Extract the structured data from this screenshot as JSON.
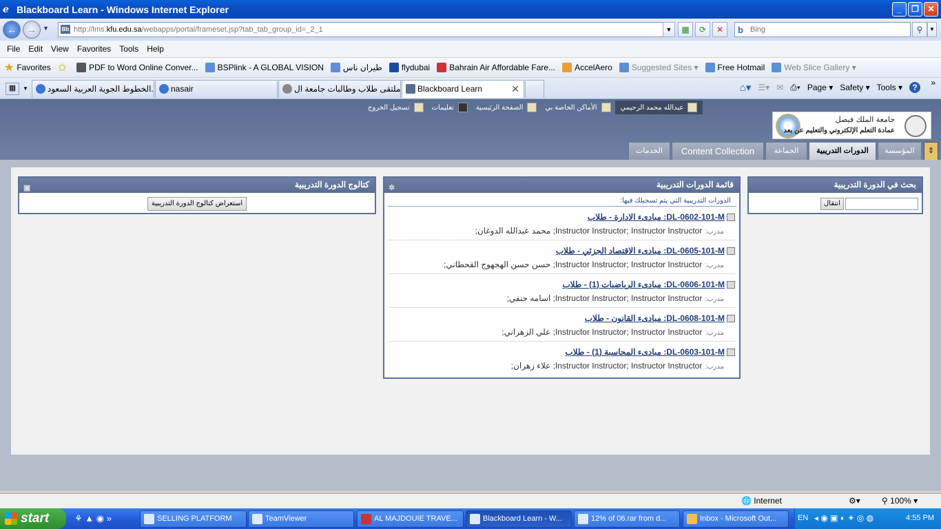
{
  "window": {
    "title": "Blackboard Learn - Windows Internet Explorer"
  },
  "address": {
    "url_prefix": "http://lms.",
    "url_domain": "kfu.edu.sa",
    "url_suffix": "/webapps/portal/frameset.jsp?tab_tab_group_id=_2_1",
    "favicon": "Bb",
    "search_placeholder": "Bing"
  },
  "menu": [
    "File",
    "Edit",
    "View",
    "Favorites",
    "Tools",
    "Help"
  ],
  "favorites_bar": {
    "label": "Favorites",
    "items": [
      {
        "label": "PDF to Word Online Conver...",
        "gray": false
      },
      {
        "label": "BSPlink - A GLOBAL VISION",
        "gray": false
      },
      {
        "label": "طيران ناس",
        "gray": false
      },
      {
        "label": "flydubai",
        "gray": false
      },
      {
        "label": "Bahrain Air  Affordable Fare...",
        "gray": false
      },
      {
        "label": "AccelAero",
        "gray": false
      },
      {
        "label": "Suggested Sites ▾",
        "gray": true
      },
      {
        "label": "Free Hotmail",
        "gray": false
      },
      {
        "label": "Web Slice Gallery ▾",
        "gray": true
      }
    ]
  },
  "ie_tabs": [
    {
      "label": "الخطوط الجوية العربية السعود...",
      "active": false
    },
    {
      "label": "nasair",
      "active": false
    },
    {
      "label": "ملتقى طلاب وطالبات جامعة ال...",
      "active": false
    },
    {
      "label": "Blackboard Learn",
      "active": true
    }
  ],
  "command_bar": [
    "Page ▾",
    "Safety ▾",
    "Tools ▾"
  ],
  "bb_userbar": {
    "user": "عبدالله محمد الرحيمي",
    "my_places": "الأماكن الخاصة بي",
    "home": "الصفحة الرئيسية",
    "help": "تعليمات",
    "logout": "تسجيل الخروج"
  },
  "logo": {
    "line1": "جامعة الملك فيصل",
    "line2": "عمادة التعلم الإلكتروني والتعليم عن بعد"
  },
  "bb_tabs": [
    {
      "label": "المؤسسة",
      "active": false
    },
    {
      "label": "الدورات التدريبية",
      "active": true
    },
    {
      "label": "الجماعة",
      "active": false
    },
    {
      "label": "Content Collection",
      "active": false
    },
    {
      "label": "الخدمات",
      "active": false
    }
  ],
  "search_module": {
    "title": "بحث في الدورة التدريبية",
    "go_button": "انتقال",
    "input_value": ""
  },
  "courses_module": {
    "title": "قائمة الدورات التدريبية",
    "subtitle": "الدورات التدريبية التي يتم تسجيلك فيها:",
    "instructor_label": "مدرب:",
    "courses": [
      {
        "code": "DL-0602-101-M",
        "name": "مبادىء الادارة - طلاب",
        "instructors": "Instructor Instructor;  Instructor Instructor;  محمد عبدالله الدوغان;"
      },
      {
        "code": "DL-0605-101-M",
        "name": "مبادىء الاقتصاد الجزئي - طلاب",
        "instructors": "Instructor Instructor;  Instructor Instructor;  حسن حسن الهجهوج القحطاني;"
      },
      {
        "code": "DL-0606-101-M",
        "name": "مبادىء الرياضيات (1) - طلاب",
        "instructors": "Instructor Instructor;  Instructor Instructor;  اسامه حنفي;"
      },
      {
        "code": "DL-0608-101-M",
        "name": "مبادىء القانون - طلاب",
        "instructors": "Instructor Instructor;  Instructor Instructor;  علي الزهراني;"
      },
      {
        "code": "DL-0603-101-M",
        "name": "مبادىء المحاسبة (1) - طلاب",
        "instructors": "Instructor Instructor;  Instructor Instructor;  علاء زهران;"
      }
    ]
  },
  "catalog_module": {
    "title": "كتالوج الدورة التدريبية",
    "button": "استعراض كتالوج الدورة التدريبية"
  },
  "statusbar": {
    "zone": "Internet",
    "zoom": "100%"
  },
  "taskbar": {
    "start": "start",
    "buttons": [
      {
        "label": "SELLING PLATFORM",
        "active": false
      },
      {
        "label": "TeamViewer",
        "active": false
      },
      {
        "label": "AL MAJDOUIE TRAVE...",
        "active": false
      },
      {
        "label": "Blackboard Learn - W...",
        "active": true
      },
      {
        "label": "12% of 06.rar from d...",
        "active": false
      },
      {
        "label": "Inbox - Microsoft Out...",
        "active": false
      }
    ],
    "lang": "EN",
    "clock": "4:55 PM"
  }
}
